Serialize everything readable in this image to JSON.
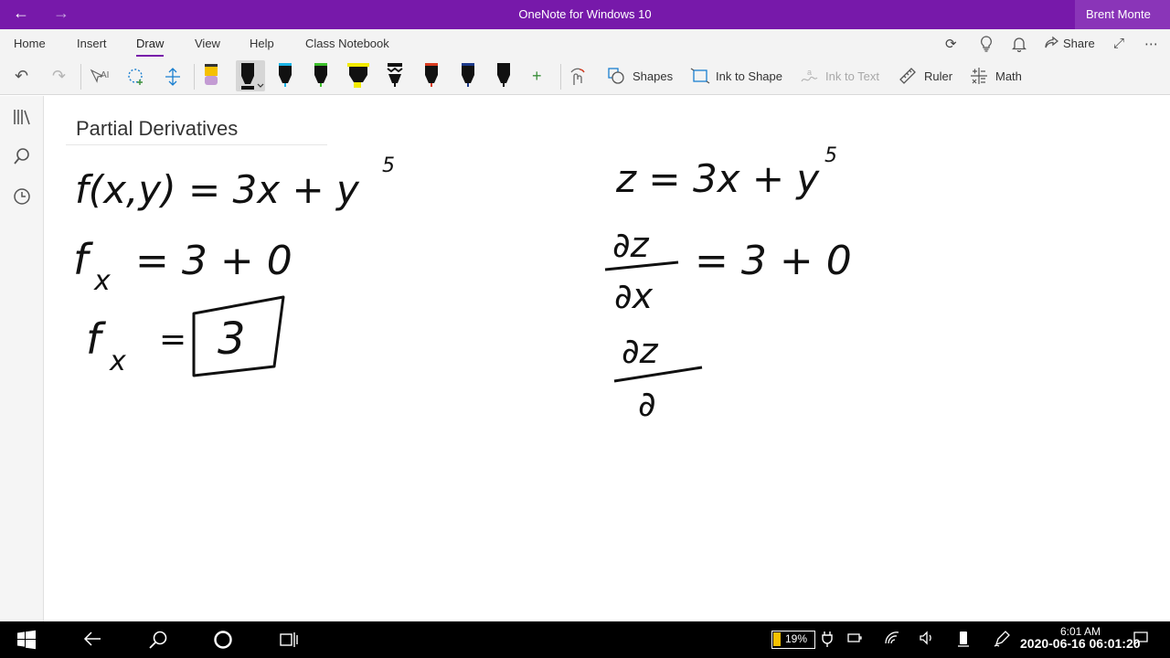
{
  "titlebar": {
    "back_glyph": "←",
    "forward_glyph": "→",
    "title": "OneNote for Windows 10",
    "user": "Brent Monte"
  },
  "menu": {
    "items": [
      "Home",
      "Insert",
      "Draw",
      "View",
      "Help",
      "Class Notebook"
    ],
    "active": "Draw",
    "share_label": "Share"
  },
  "toolbar": {
    "shapes_label": "Shapes",
    "ink_to_shape_label": "Ink to Shape",
    "ink_to_text_label": "Ink to Text",
    "ruler_label": "Ruler",
    "math_label": "Math",
    "pens": [
      {
        "icon": "eraser-icon",
        "color": "#c39bd3"
      },
      {
        "icon": "pen-black-selected-icon",
        "color": "#111111"
      },
      {
        "icon": "pen-cyan-icon",
        "color": "#1ab3e6"
      },
      {
        "icon": "pen-green-icon",
        "color": "#3cbf2a"
      },
      {
        "icon": "highlighter-yellow-icon",
        "color": "#f2ea00"
      },
      {
        "icon": "pen-galaxy-icon",
        "color": "#222222"
      },
      {
        "icon": "pen-red-icon",
        "color": "#d93b1f"
      },
      {
        "icon": "pen-navy-icon",
        "color": "#1d3a8a"
      },
      {
        "icon": "pen-black-icon",
        "color": "#111111"
      }
    ]
  },
  "page": {
    "title": "Partial Derivatives",
    "ink": {
      "left_line1": "f(x,y) = 3x + y",
      "left_line1_exp": "5",
      "left_line2": "f",
      "left_line2_sub": "x",
      "left_line2_rhs": "= 3 + 0",
      "left_line3": "f",
      "left_line3_sub": "x",
      "left_line3_eq": "=",
      "left_line3_box": "3",
      "right_line1": "z = 3x + y",
      "right_line1_exp": "5",
      "right_frac1_num": "∂z",
      "right_frac1_den": "∂x",
      "right_frac1_rhs": "= 3 + 0",
      "right_frac2_num": "∂z",
      "right_frac2_den": "∂"
    }
  },
  "taskbar": {
    "battery": "19%",
    "time": "6:01 AM",
    "date_overlay": "2020-06-16 06:01:20"
  },
  "colors": {
    "accent": "#7719aa",
    "ink": "#111111"
  }
}
